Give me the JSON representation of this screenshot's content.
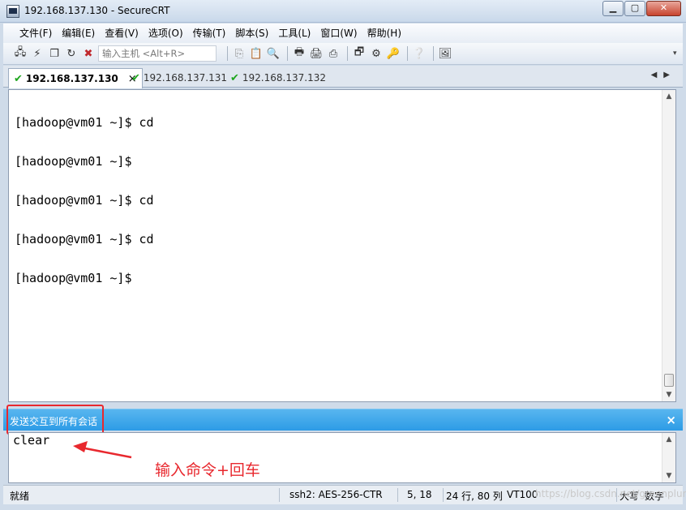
{
  "window": {
    "title": "192.168.137.130 - SecureCRT"
  },
  "menu": [
    "文件(F)",
    "编辑(E)",
    "查看(V)",
    "选项(O)",
    "传输(T)",
    "脚本(S)",
    "工具(L)",
    "窗口(W)",
    "帮助(H)"
  ],
  "toolbar": {
    "host_placeholder": "输入主机 <Alt+R>",
    "icons_left": [
      "connect-icon",
      "quick-connect-icon",
      "connect-in-tab-icon",
      "reconnect-icon",
      "disconnect-icon"
    ],
    "icons_right": [
      "copy-icon",
      "paste-icon",
      "find-icon",
      "print-icon",
      "print-selection-icon",
      "print-setup-icon",
      "session-options-icon",
      "global-options-icon",
      "keymap-icon",
      "help-icon",
      "sftp-icon"
    ]
  },
  "tabs": [
    {
      "label": "192.168.137.130",
      "active": true
    },
    {
      "label": "192.168.137.131",
      "active": false
    },
    {
      "label": "192.168.137.132",
      "active": false
    }
  ],
  "terminal": {
    "lines": [
      "[hadoop@vm01 ~]$ cd",
      "[hadoop@vm01 ~]$",
      "[hadoop@vm01 ~]$ cd",
      "[hadoop@vm01 ~]$ cd",
      "[hadoop@vm01 ~]$"
    ]
  },
  "send_bar": {
    "label": "发送交互到所有会话",
    "close": "×"
  },
  "command_window": {
    "text": "clear"
  },
  "annotation": {
    "text": "输入命令+回车",
    "color": "#e8282e"
  },
  "status": {
    "ready": "就绪",
    "cipher": "ssh2: AES-256-CTR",
    "cursor": "5,  18",
    "size": "24 行, 80 列",
    "term": "VT100",
    "caps": "大写",
    "num": "数字"
  },
  "watermark": "https://blog.csdn.net/greenplum..."
}
